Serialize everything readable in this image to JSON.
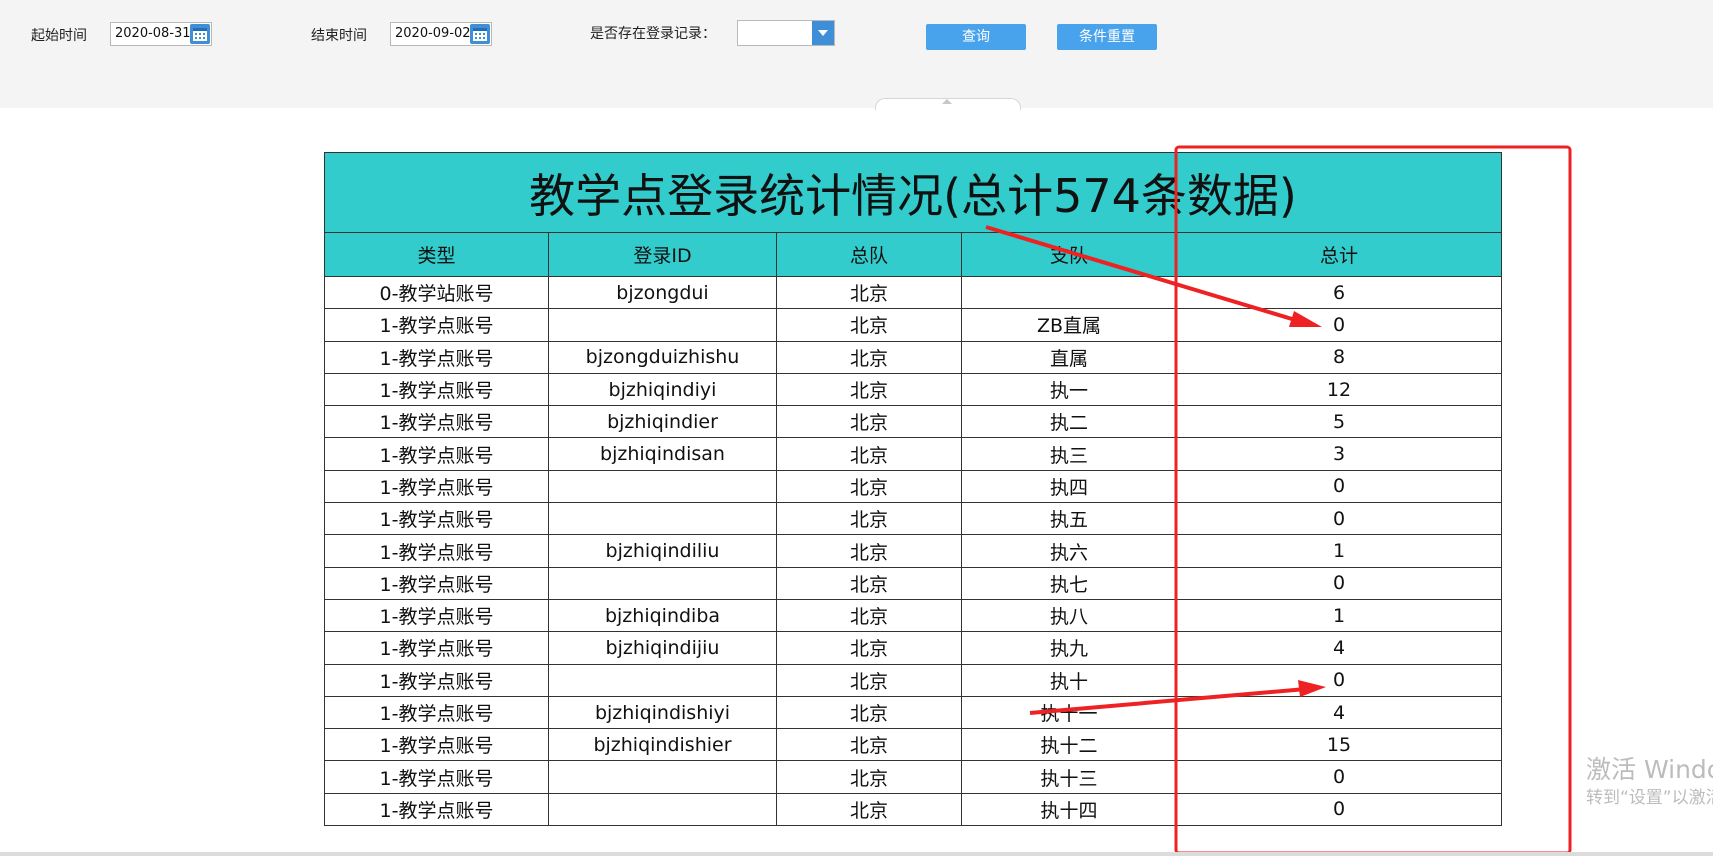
{
  "filters": {
    "start_label": "起始时间",
    "start_value": "2020-08-31...",
    "end_label": "结束时间",
    "end_value": "2020-09-02...",
    "login_label": "是否存在登录记录：",
    "login_value": "",
    "query_button": "查询",
    "reset_button": "条件重置"
  },
  "report": {
    "title": "教学点登录统计情况(总计574条数据)",
    "columns": [
      "类型",
      "登录ID",
      "总队",
      "支队",
      "总计"
    ],
    "rows": [
      [
        "0-教学站账号",
        "bjzongdui",
        "北京",
        "",
        "6"
      ],
      [
        "1-教学点账号",
        "",
        "北京",
        "ZB直属",
        "0"
      ],
      [
        "1-教学点账号",
        "bjzongduizhishu",
        "北京",
        "直属",
        "8"
      ],
      [
        "1-教学点账号",
        "bjzhiqindiyi",
        "北京",
        "执一",
        "12"
      ],
      [
        "1-教学点账号",
        "bjzhiqindier",
        "北京",
        "执二",
        "5"
      ],
      [
        "1-教学点账号",
        "bjzhiqindisan",
        "北京",
        "执三",
        "3"
      ],
      [
        "1-教学点账号",
        "",
        "北京",
        "执四",
        "0"
      ],
      [
        "1-教学点账号",
        "",
        "北京",
        "执五",
        "0"
      ],
      [
        "1-教学点账号",
        "bjzhiqindiliu",
        "北京",
        "执六",
        "1"
      ],
      [
        "1-教学点账号",
        "",
        "北京",
        "执七",
        "0"
      ],
      [
        "1-教学点账号",
        "bjzhiqindiba",
        "北京",
        "执八",
        "1"
      ],
      [
        "1-教学点账号",
        "bjzhiqindijiu",
        "北京",
        "执九",
        "4"
      ],
      [
        "1-教学点账号",
        "",
        "北京",
        "执十",
        "0"
      ],
      [
        "1-教学点账号",
        "bjzhiqindishiyi",
        "北京",
        "执十一",
        "4"
      ],
      [
        "1-教学点账号",
        "bjzhiqindishier",
        "北京",
        "执十二",
        "15"
      ],
      [
        "1-教学点账号",
        "",
        "北京",
        "执十三",
        "0"
      ],
      [
        "1-教学点账号",
        "",
        "北京",
        "执十四",
        "0"
      ]
    ]
  },
  "watermark": {
    "line1": "激活 Windo",
    "line2": "转到“设置”以激活"
  },
  "colors": {
    "header_bg": "#33cccc",
    "button_bg": "#49a3ec",
    "annotation": "#ee2222"
  }
}
